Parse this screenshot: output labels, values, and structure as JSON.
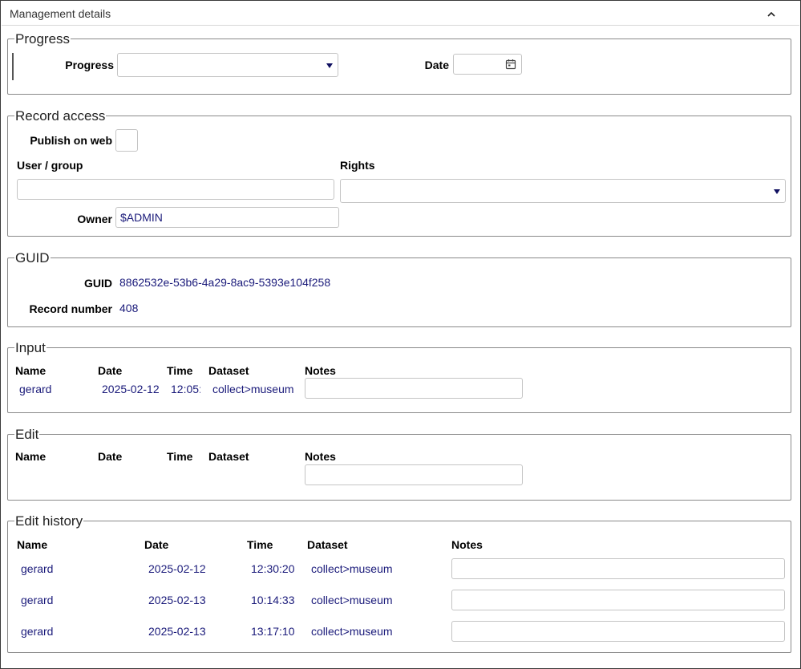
{
  "panel": {
    "title": "Management details"
  },
  "progress": {
    "legend": "Progress",
    "progress_label": "Progress",
    "progress_value": "",
    "date_label": "Date",
    "date_value": ""
  },
  "record_access": {
    "legend": "Record access",
    "publish_label": "Publish on web",
    "user_group_label": "User / group",
    "user_group_value": "",
    "rights_label": "Rights",
    "rights_value": "",
    "owner_label": "Owner",
    "owner_value": "$ADMIN"
  },
  "guid": {
    "legend": "GUID",
    "guid_label": "GUID",
    "guid_value": "8862532e-53b6-4a29-8ac9-5393e104f258",
    "record_number_label": "Record number",
    "record_number_value": "408"
  },
  "input": {
    "legend": "Input",
    "headers": {
      "name": "Name",
      "date": "Date",
      "time": "Time",
      "dataset": "Dataset",
      "notes": "Notes"
    },
    "row": {
      "name": "gerard",
      "date": "2025-02-12",
      "time": "12:05:",
      "dataset": "collect>museum",
      "notes": ""
    }
  },
  "edit": {
    "legend": "Edit",
    "headers": {
      "name": "Name",
      "date": "Date",
      "time": "Time",
      "dataset": "Dataset",
      "notes": "Notes"
    }
  },
  "edit_history": {
    "legend": "Edit history",
    "headers": {
      "name": "Name",
      "date": "Date",
      "time": "Time",
      "dataset": "Dataset",
      "notes": "Notes"
    },
    "rows": [
      {
        "name": "gerard",
        "date": "2025-02-12",
        "time": "12:30:20",
        "dataset": "collect>museum",
        "notes": ""
      },
      {
        "name": "gerard",
        "date": "2025-02-13",
        "time": "10:14:33",
        "dataset": "collect>museum",
        "notes": ""
      },
      {
        "name": "gerard",
        "date": "2025-02-13",
        "time": "13:17:10",
        "dataset": "collect>museum",
        "notes": ""
      }
    ]
  },
  "icons": {
    "collapse": "chevron-up-icon",
    "calendar": "calendar-icon",
    "dropdown": "triangle-down-icon"
  },
  "colors": {
    "value_text": "#1a1a7a",
    "border": "#8a8a8a",
    "arrow": "#101060"
  }
}
